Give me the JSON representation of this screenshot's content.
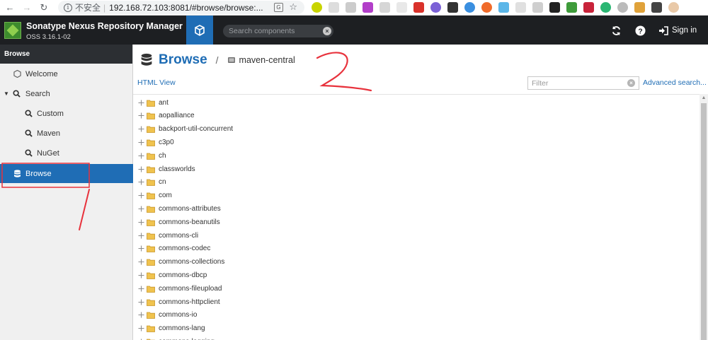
{
  "browser": {
    "insecure_label": "不安全",
    "url": "192.168.72.103:8081/#browse/browse:..."
  },
  "header": {
    "app_title": "Sonatype Nexus Repository Manager",
    "version": "OSS 3.16.1-02",
    "search_placeholder": "Search components",
    "signin_label": "Sign in"
  },
  "sidebar": {
    "title": "Browse",
    "items": [
      {
        "label": "Welcome",
        "icon": "hexagon-icon"
      },
      {
        "label": "Search",
        "icon": "search-icon"
      },
      {
        "label": "Custom",
        "icon": "search-icon"
      },
      {
        "label": "Maven",
        "icon": "search-icon"
      },
      {
        "label": "NuGet",
        "icon": "search-icon"
      },
      {
        "label": "Browse",
        "icon": "database-icon"
      }
    ]
  },
  "main": {
    "title": "Browse",
    "repository": "maven-central",
    "html_view_label": "HTML View",
    "filter_placeholder": "Filter",
    "advanced_search_label": "Advanced search...",
    "tree_items": [
      "ant",
      "aopalliance",
      "backport-util-concurrent",
      "c3p0",
      "ch",
      "classworlds",
      "cn",
      "com",
      "commons-attributes",
      "commons-beanutils",
      "commons-cli",
      "commons-codec",
      "commons-collections",
      "commons-dbcp",
      "commons-fileupload",
      "commons-httpclient",
      "commons-io",
      "commons-lang",
      "commons-logging"
    ]
  },
  "colors": {
    "accent": "#1f6db5",
    "header_bg": "#1d1f22",
    "folder": "#f0c34e",
    "annotation": "#e8323c"
  }
}
